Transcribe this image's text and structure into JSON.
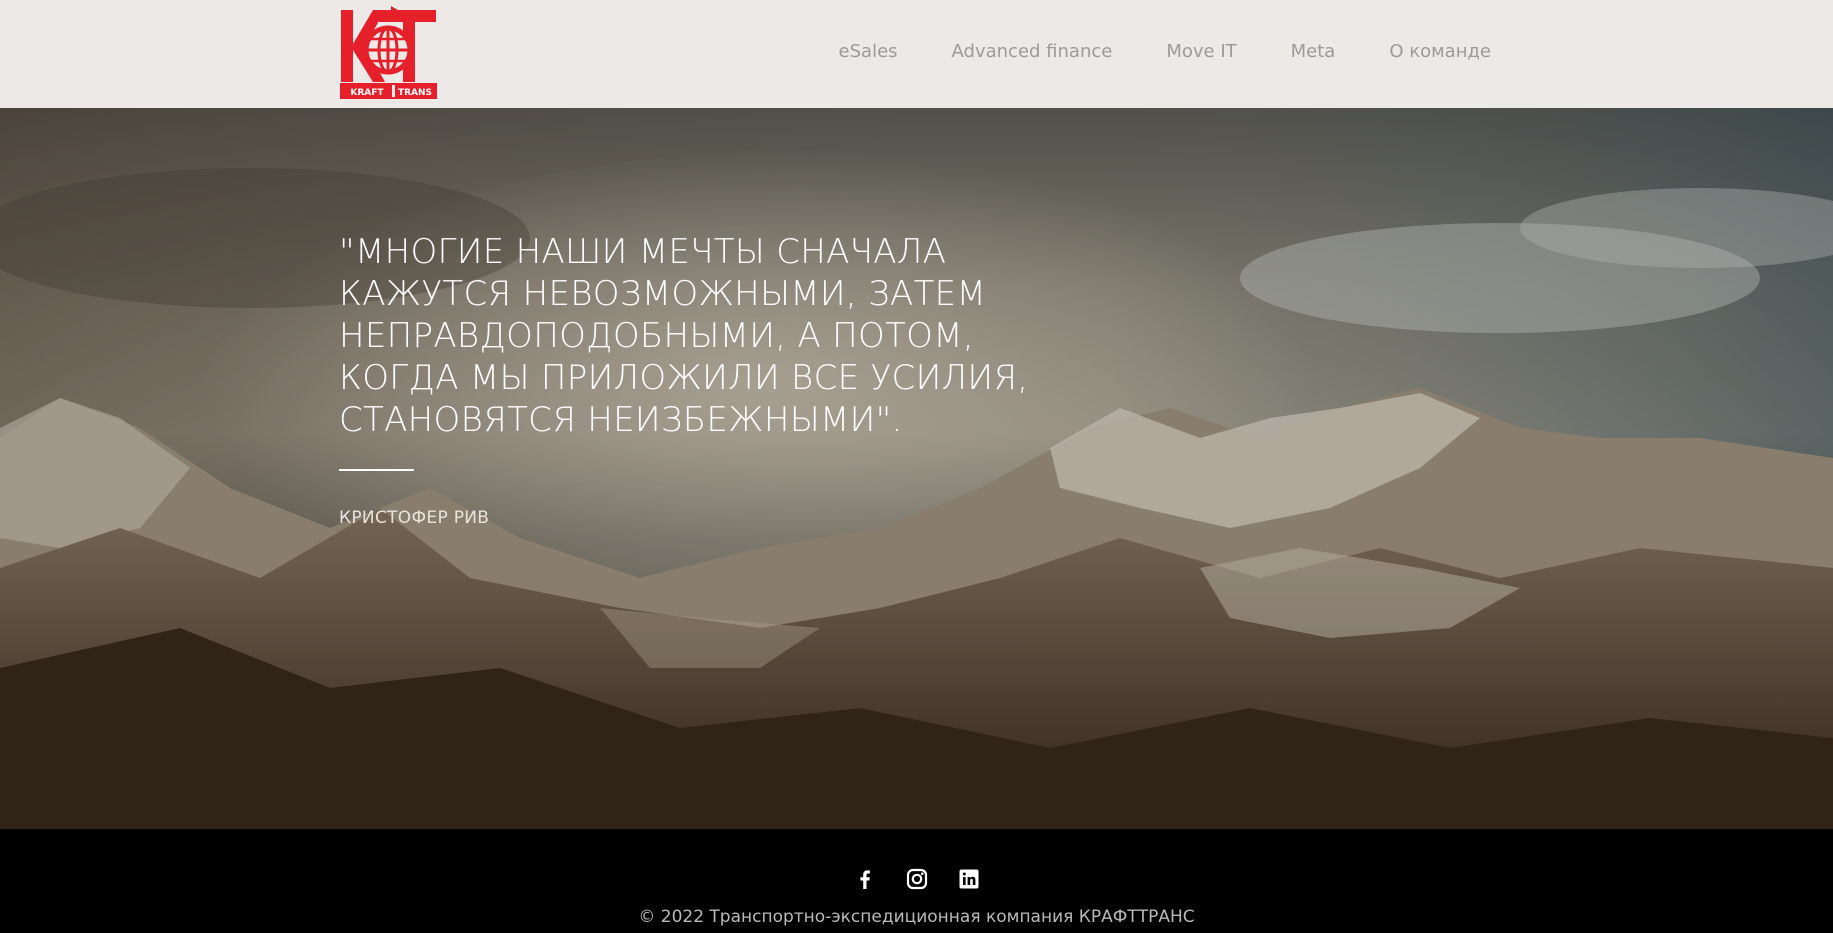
{
  "header": {
    "logo_text": "KRAFT TRANS",
    "nav": [
      "eSales",
      "Advanced finance",
      "Move IT",
      "Meta",
      "О команде"
    ]
  },
  "hero": {
    "quote": "\"Многие наши мечты сначала кажутся невозможными, затем неправдоподобными, а потом, когда мы приложили все усилия, становятся неизбежными\".",
    "author": "Кристофер Рив"
  },
  "footer": {
    "social": [
      "facebook-icon",
      "instagram-icon",
      "linkedin-icon"
    ],
    "copyright": "© 2022 Транспортно-экспедиционная компания КРАФТТРАНС"
  },
  "colors": {
    "header_bg": "#ede9e7",
    "brand_red": "#e5202a",
    "nav_text": "#9b9b9b",
    "footer_bg": "#000000"
  }
}
